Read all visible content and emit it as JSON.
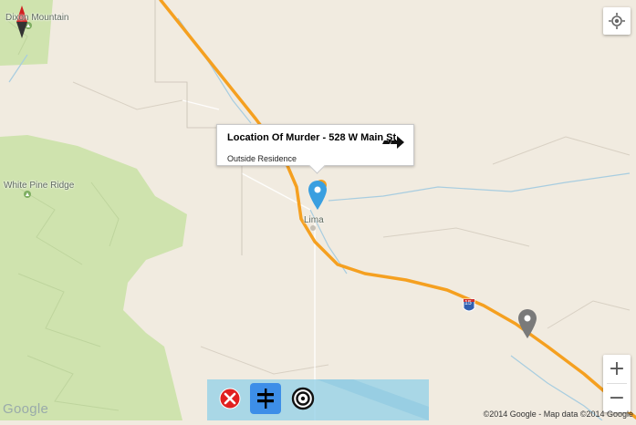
{
  "map": {
    "place_labels": [
      {
        "id": "mountain",
        "text": "Dixon Mountain"
      },
      {
        "id": "white-pine",
        "text": "White Pine Ridge"
      },
      {
        "id": "lima",
        "text": "Lima"
      }
    ],
    "interstate_shield": "15",
    "copyright": "©2014 Google - Map data ©2014 Google",
    "logo": "Google"
  },
  "info_window": {
    "title": "Location Of Murder - 528 W Main St",
    "snippet": "Outside Residence"
  },
  "markers": [
    {
      "name": "murder-location-marker",
      "color": "#3a9fe0"
    },
    {
      "name": "second-marker",
      "color": "#7a7a7a"
    }
  ],
  "controls": {
    "zoom_in": "+",
    "zoom_out": "−"
  },
  "colors": {
    "land": "#f1ebe0",
    "forest": "#cfe3ae",
    "highway": "#f5a020",
    "water": "#a8cde0",
    "toolbar_bg": "#90d0e8",
    "active_button": "#3d8ee8",
    "close_button": "#e02020"
  },
  "toolbar": {
    "buttons": [
      {
        "name": "close-button",
        "icon": "close-circle-icon",
        "active": false
      },
      {
        "name": "directions-button",
        "icon": "signpost-icon",
        "active": true
      },
      {
        "name": "target-button",
        "icon": "target-icon",
        "active": false
      }
    ]
  }
}
